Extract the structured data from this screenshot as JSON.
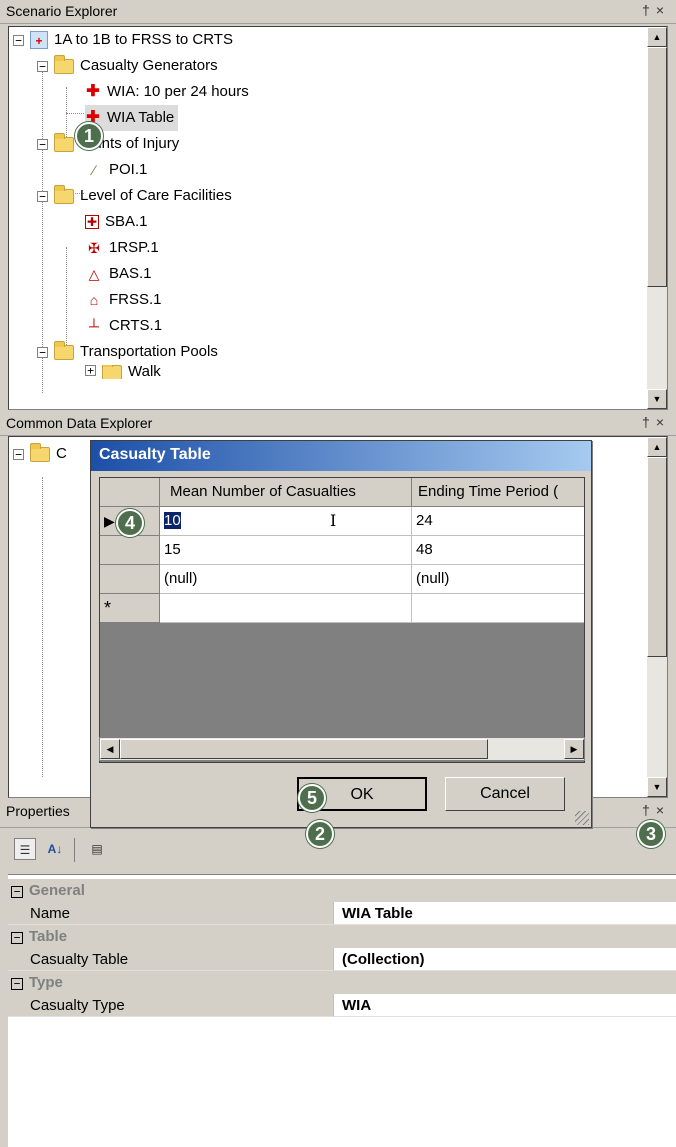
{
  "scenario_explorer": {
    "title": "Scenario Explorer",
    "pin": " †",
    "close": "×",
    "tree": {
      "root": "1A to 1B to FRSS to CRTS",
      "casualty_generators": "Casualty Generators",
      "wia_24": "WIA: 10 per 24 hours",
      "wia_table": "WIA Table",
      "points_of_injury": "Points of Injury",
      "poi1": "POI.1",
      "level_of_care": "Level of Care Facilities",
      "sba1": "SBA.1",
      "rsp1": "1RSP.1",
      "bas1": "BAS.1",
      "frss1": "FRSS.1",
      "crts1": "CRTS.1",
      "transportation_pools": "Transportation Pools",
      "walk": "Walk"
    }
  },
  "common_data_explorer": {
    "title": "Common Data Explorer",
    "root_letter": "C"
  },
  "casualty_dialog": {
    "title": "Casualty Table",
    "columns": [
      "Mean Number of Casualties",
      "Ending Time Period ("
    ],
    "rows": [
      {
        "mean": "10",
        "end": "24"
      },
      {
        "mean": "15",
        "end": "48"
      },
      {
        "mean": "(null)",
        "end": "(null)"
      }
    ],
    "new_row_marker": "*",
    "current_row_marker": "▶",
    "ok_label": "OK",
    "cancel_label": "Cancel"
  },
  "properties": {
    "title": "Properties",
    "categories": [
      {
        "name": "General",
        "prop": "Name",
        "value": "WIA Table"
      },
      {
        "name": "Table",
        "prop": "Casualty Table",
        "value": "(Collection)"
      },
      {
        "name": "Type",
        "prop": "Casualty Type",
        "value": "WIA"
      }
    ]
  },
  "callouts": [
    "1",
    "2",
    "3",
    "4",
    "5"
  ],
  "icons": {
    "expander": "−",
    "collapsed": "+",
    "scroll_up": "▲",
    "scroll_down": "▼",
    "scroll_left": "◀",
    "scroll_right": "▶",
    "text_cursor": "I"
  },
  "colors": {
    "callout": "#4e6e4e",
    "dialog_title_start": "#1c4fa7",
    "dialog_title_end": "#a6caf0"
  }
}
